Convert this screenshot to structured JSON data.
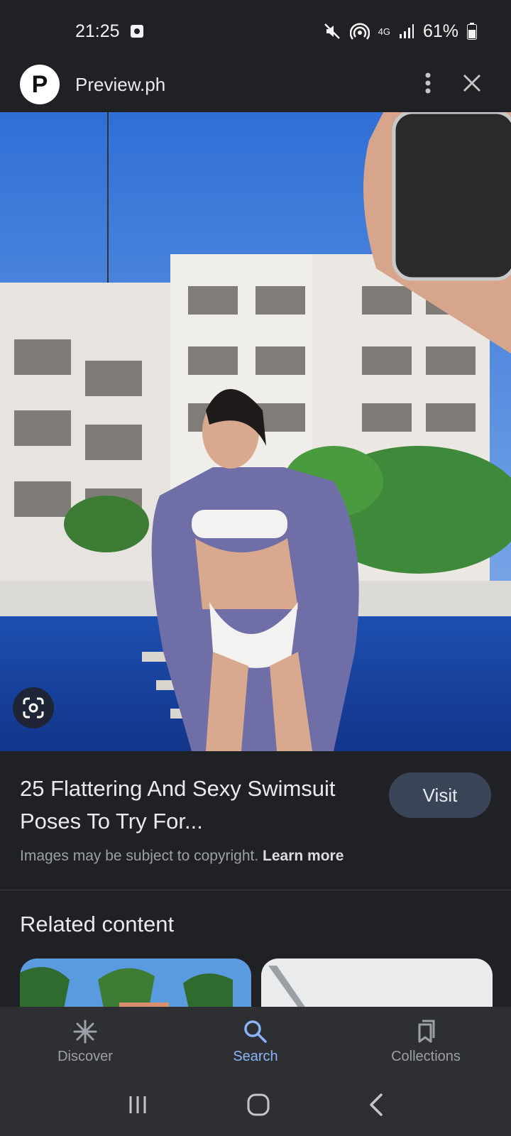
{
  "status_bar": {
    "time": "21:25",
    "network": "4G",
    "battery": "61%"
  },
  "header": {
    "logo_letter": "P",
    "site_name": "Preview.ph"
  },
  "result": {
    "title": "25 Flattering And Sexy Swimsuit Poses To Try For...",
    "visit_label": "Visit",
    "copyright_text": "Images may be subject to copyright.",
    "learn_more_label": "Learn more"
  },
  "related": {
    "title": "Related content"
  },
  "bottom_nav": {
    "items": [
      {
        "label": "Discover",
        "icon": "asterisk-icon",
        "active": false
      },
      {
        "label": "Search",
        "icon": "search-icon",
        "active": true
      },
      {
        "label": "Collections",
        "icon": "bookmark-icon",
        "active": false
      }
    ]
  },
  "colors": {
    "background": "#202124",
    "active_accent": "#8ab4f8",
    "visit_button": "#394457"
  }
}
